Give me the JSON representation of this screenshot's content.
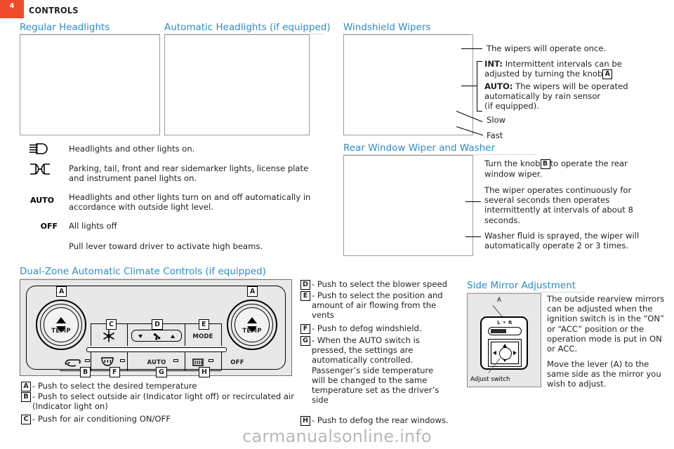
{
  "header": {
    "page_number": "4",
    "chapter_title": "CONTROLS"
  },
  "sections": {
    "regular_headlights": {
      "heading": "Regular Headlights"
    },
    "automatic_headlights": {
      "heading": "Automatic Headlights (if equipped)"
    },
    "windshield_wipers": {
      "heading": "Windshield Wipers"
    },
    "rear_wiper": {
      "heading": "Rear Window Wiper and Washer"
    },
    "climate": {
      "heading": "Dual-Zone Automatic Climate Controls (if equipped)"
    },
    "mirror": {
      "heading": "Side Mirror Adjustment"
    }
  },
  "headlight_symbols": [
    {
      "symbol": "headlight-beam-icon",
      "text": "Headlights and other lights on."
    },
    {
      "symbol": "parking-light-icon",
      "text": "Parking, tail, front and rear sidemarker lights, license plate and instrument panel lights on."
    },
    {
      "symbol": "AUTO",
      "text": "Headlights and other lights turn on and off automatically in accordance with outside light level."
    },
    {
      "symbol": "OFF",
      "text": "All lights off"
    },
    {
      "symbol": "",
      "text": "Pull lever toward driver to activate high beams."
    }
  ],
  "wiper_callouts": {
    "once": "The wipers will operate once.",
    "int_label": "INT:",
    "int_text_a": "Intermittent intervals can be",
    "int_text_b": "adjusted by turning the knob",
    "int_knob": "A",
    "auto_label": "AUTO:",
    "auto_text_a": "The wipers will be operated",
    "auto_text_b": "automatically by rain sensor",
    "auto_text_c": "(if equipped).",
    "slow": "Slow",
    "fast": "Fast"
  },
  "rear_wiper_callouts": {
    "p1_a": "Turn the knob",
    "p1_knob": "B",
    "p1_b": "to operate the rear",
    "p1_c": "window wiper.",
    "p2": "The wiper operates continuously for several seconds then operates intermittently at intervals of about 8 seconds.",
    "p3": "Washer fluid is sprayed, the wiper will automatically operate 2 or 3 times."
  },
  "climate_panel": {
    "temp_left_label": "TEMP",
    "temp_right_label": "TEMP",
    "marker_a_left": "A",
    "marker_a_right": "A",
    "marker_c": "C",
    "marker_d": "D",
    "marker_e": "E",
    "marker_b": "B",
    "marker_f": "F",
    "marker_g": "G",
    "marker_h": "H",
    "mode_label": "MODE",
    "auto_label": "AUTO",
    "off_label": "OFF",
    "ac_icon": "snowflake-icon",
    "blower_icon": "fan-icon",
    "blower_down_icon": "triangle-down-icon",
    "blower_up_icon": "triangle-up-icon",
    "recirc_icon": "air-recirculation-icon",
    "defrost_icon": "front-defrost-icon",
    "rear_defog_icon": "rear-defog-icon"
  },
  "climate_captions": [
    {
      "key": "A",
      "text": "- Push to select the desired temperature"
    },
    {
      "key": "B",
      "text": "- Push to select outside air (Indicator light off) or recirculated air (Indicator light on)"
    },
    {
      "key": "C",
      "text": "- Push for air conditioning ON/OFF"
    },
    {
      "key": "D",
      "text": "- Push to select the blower speed"
    },
    {
      "key": "E",
      "text": "- Push to select the position and amount of air flowing from the vents"
    },
    {
      "key": "F",
      "text": "- Push to defog windshield."
    },
    {
      "key": "G",
      "text": "- When the AUTO switch is pressed, the settings are automatically controlled. Passenger’s side temperature will be changed to the same temperature set as the driver’s side"
    },
    {
      "key": "H",
      "text": "- Push to defog the rear windows."
    }
  ],
  "mirror": {
    "marker_a": "A",
    "lr_label": "L • R",
    "adjust_switch_label": "Adjust switch",
    "para1": "The outside rearview mirrors can be adjusted when the ignition switch is in the “ON” or “ACC” position or the operation mode is put in ON or ACC.",
    "para2": "Move the lever (A) to the same side as the mirror you wish to adjust."
  },
  "watermark": "carmanualsonline.info",
  "colors": {
    "heading_blue": "#2e8bc9",
    "badge_red": "#f04b2a",
    "text_black": "#231f20"
  }
}
